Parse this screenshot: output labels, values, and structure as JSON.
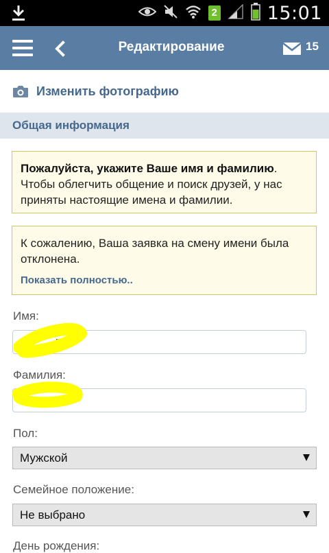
{
  "status_bar": {
    "time": "15:01",
    "sim_slot": "2",
    "icons": [
      "download-icon",
      "eye-icon",
      "mute-icon",
      "wifi-icon",
      "signal-icon",
      "battery-icon"
    ]
  },
  "header": {
    "title": "Редактирование",
    "unread_count": "15"
  },
  "photo": {
    "change_label": "Изменить фотографию"
  },
  "section": {
    "title": "Общая информация"
  },
  "notices": {
    "name_notice_bold": "Пожалуйста, укажите Ваше имя и фамилию",
    "name_notice_rest": ". Чтобы облегчить общение и поиск друзей, у нас приняты настоящие имена и фамилии.",
    "rejected_text": "К сожалению, Ваша заявка на смену имени была отклонена.",
    "show_more": "Показать полностью.."
  },
  "form": {
    "first_name_label": "Имя:",
    "first_name_value": "ра",
    "last_name_label": "Фамилия:",
    "last_name_value": "",
    "gender_label": "Пол:",
    "gender_value": "Мужской",
    "marital_label": "Семейное положение:",
    "marital_value": "Не выбрано",
    "birthday_label": "День рождения:"
  },
  "colors": {
    "header_bg": "#597da3",
    "link": "#45688e",
    "section_bg": "#dee5ec",
    "notice_bg": "#fefbe8",
    "notice_border": "#d4c466",
    "redaction": "#ffff00"
  }
}
